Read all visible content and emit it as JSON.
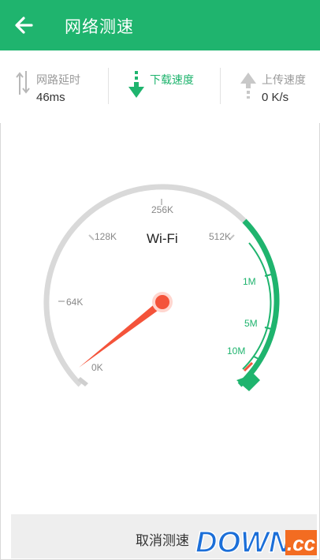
{
  "header": {
    "title": "网络测速"
  },
  "stats": {
    "latency": {
      "label": "网路延时",
      "value": "46ms"
    },
    "download": {
      "label": "下载速度"
    },
    "upload": {
      "label": "上传速度",
      "value": "0 K/s"
    }
  },
  "gauge": {
    "network": "Wi-Fi",
    "ticks": [
      "0K",
      "64K",
      "128K",
      "256K",
      "512K",
      "1M",
      "5M",
      "10M"
    ],
    "needle_value": "0K",
    "colors": {
      "track": "#d9d9d9",
      "active": "#1fb46e",
      "needle": "#f4533a",
      "accent": "#1fb46e"
    }
  },
  "footer": {
    "cancel_label": "取消测速"
  },
  "watermark": {
    "text": "DOWN",
    "suffix": ".cc"
  }
}
